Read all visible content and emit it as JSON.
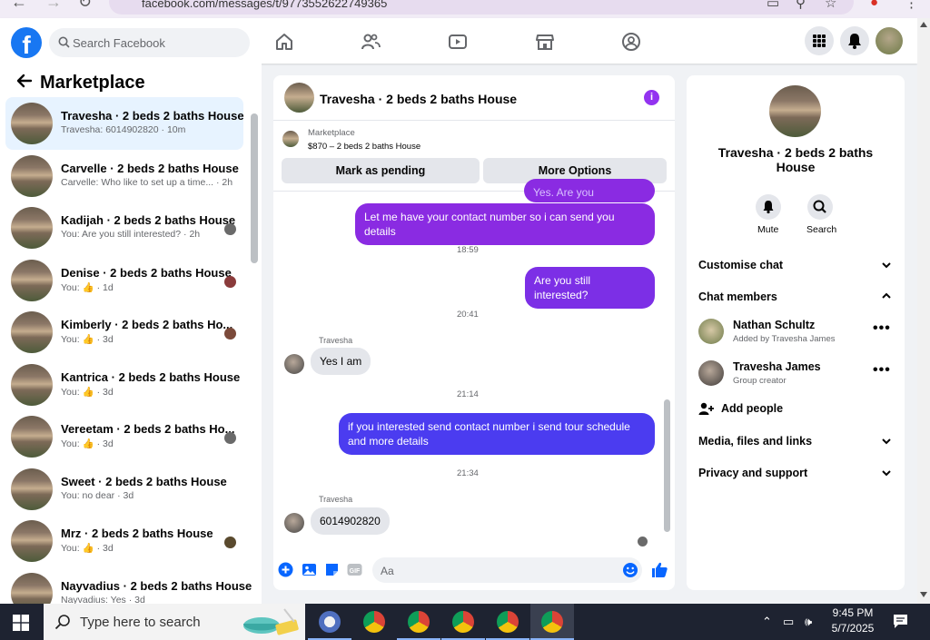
{
  "browser": {
    "url": "facebook.com/messages/t/9773552622749365"
  },
  "header": {
    "search_placeholder": "Search Facebook"
  },
  "left": {
    "title": "Marketplace",
    "conversations": [
      {
        "name": "Travesha · 2 beds 2 baths House",
        "preview": "Travesha: 6014902820 · 10m"
      },
      {
        "name": "Carvelle · 2 beds 2 baths House",
        "preview": "Carvelle: Who like to set up a time... · 2h"
      },
      {
        "name": "Kadijah · 2 beds 2 baths House",
        "preview": "You: Are you still interested? · 2h"
      },
      {
        "name": "Denise · 2 beds 2 baths House",
        "preview_prefix": "You:",
        "preview_suffix": "· 1d"
      },
      {
        "name": "Kimberly · 2 beds 2 baths Ho...",
        "preview_prefix": "You:",
        "preview_suffix": "· 3d"
      },
      {
        "name": "Kantrica · 2 beds 2 baths House",
        "preview_prefix": "You:",
        "preview_suffix": "· 3d"
      },
      {
        "name": "Vereetam · 2 beds 2 baths Ho...",
        "preview_prefix": "You:",
        "preview_suffix": "· 3d"
      },
      {
        "name": "Sweet · 2 beds 2 baths House",
        "preview": "You: no dear · 3d"
      },
      {
        "name": "Mrz · 2 beds 2 baths House",
        "preview_prefix": "You:",
        "preview_suffix": "· 3d"
      },
      {
        "name": "Nayvadius · 2 beds 2 baths House",
        "preview": "Nayvadius: Yes · 3d"
      }
    ]
  },
  "chat": {
    "title": "Travesha · 2 beds 2 baths House",
    "marketplace_label": "Marketplace",
    "listing": "$870 – 2 beds 2 baths House",
    "mark_pending": "Mark as pending",
    "more_options": "More Options",
    "partial_bubble": "Yes. Are you interested?",
    "msg1": "Let me have your contact number so i can send you details",
    "time1": "18:59",
    "msg2": "Are you still interested?",
    "time2": "20:41",
    "sender": "Travesha",
    "reply1": "Yes I am",
    "time3": "21:14",
    "msg3": "if you interested send contact number i send tour schedule and more details",
    "time4": "21:34",
    "reply2": "6014902820",
    "composer_placeholder": "Aa"
  },
  "details": {
    "title": "Travesha · 2 beds 2 baths House",
    "mute": "Mute",
    "search": "Search",
    "customise": "Customise chat",
    "members_header": "Chat members",
    "members": [
      {
        "name": "Nathan Schultz",
        "sub": "Added by Travesha James"
      },
      {
        "name": "Travesha James",
        "sub": "Group creator"
      }
    ],
    "add_people": "Add people",
    "media": "Media, files and links",
    "privacy": "Privacy and support"
  },
  "taskbar": {
    "search_placeholder": "Type here to search",
    "time": "9:45 PM",
    "date": "5/7/2025"
  },
  "colors": {
    "accent": "#1877f2",
    "bubble_purple": "#8a2be2",
    "bubble_blue": "#4b3cf0"
  }
}
